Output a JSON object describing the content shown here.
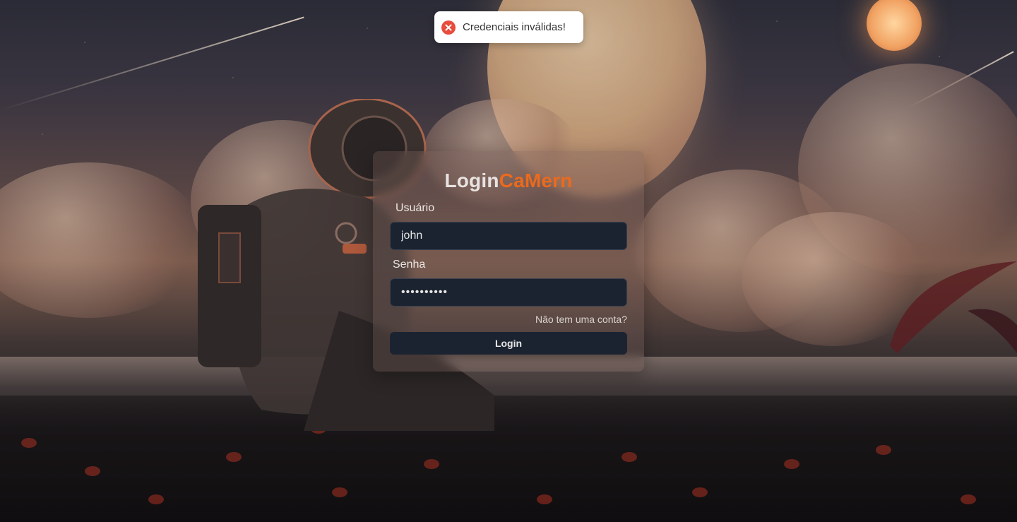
{
  "toast": {
    "icon": "error-circle-icon",
    "message": "Credenciais inválidas!",
    "color": "#e74c3c"
  },
  "login": {
    "brand_main": "Login",
    "brand_accent": "CaMern",
    "accent_color": "#ea6a1e",
    "username_label": "Usuário",
    "username_value": "john",
    "password_label": "Senha",
    "password_value": "••••••••••",
    "signup_link": "Não tem uma conta?",
    "submit_label": "Login"
  }
}
